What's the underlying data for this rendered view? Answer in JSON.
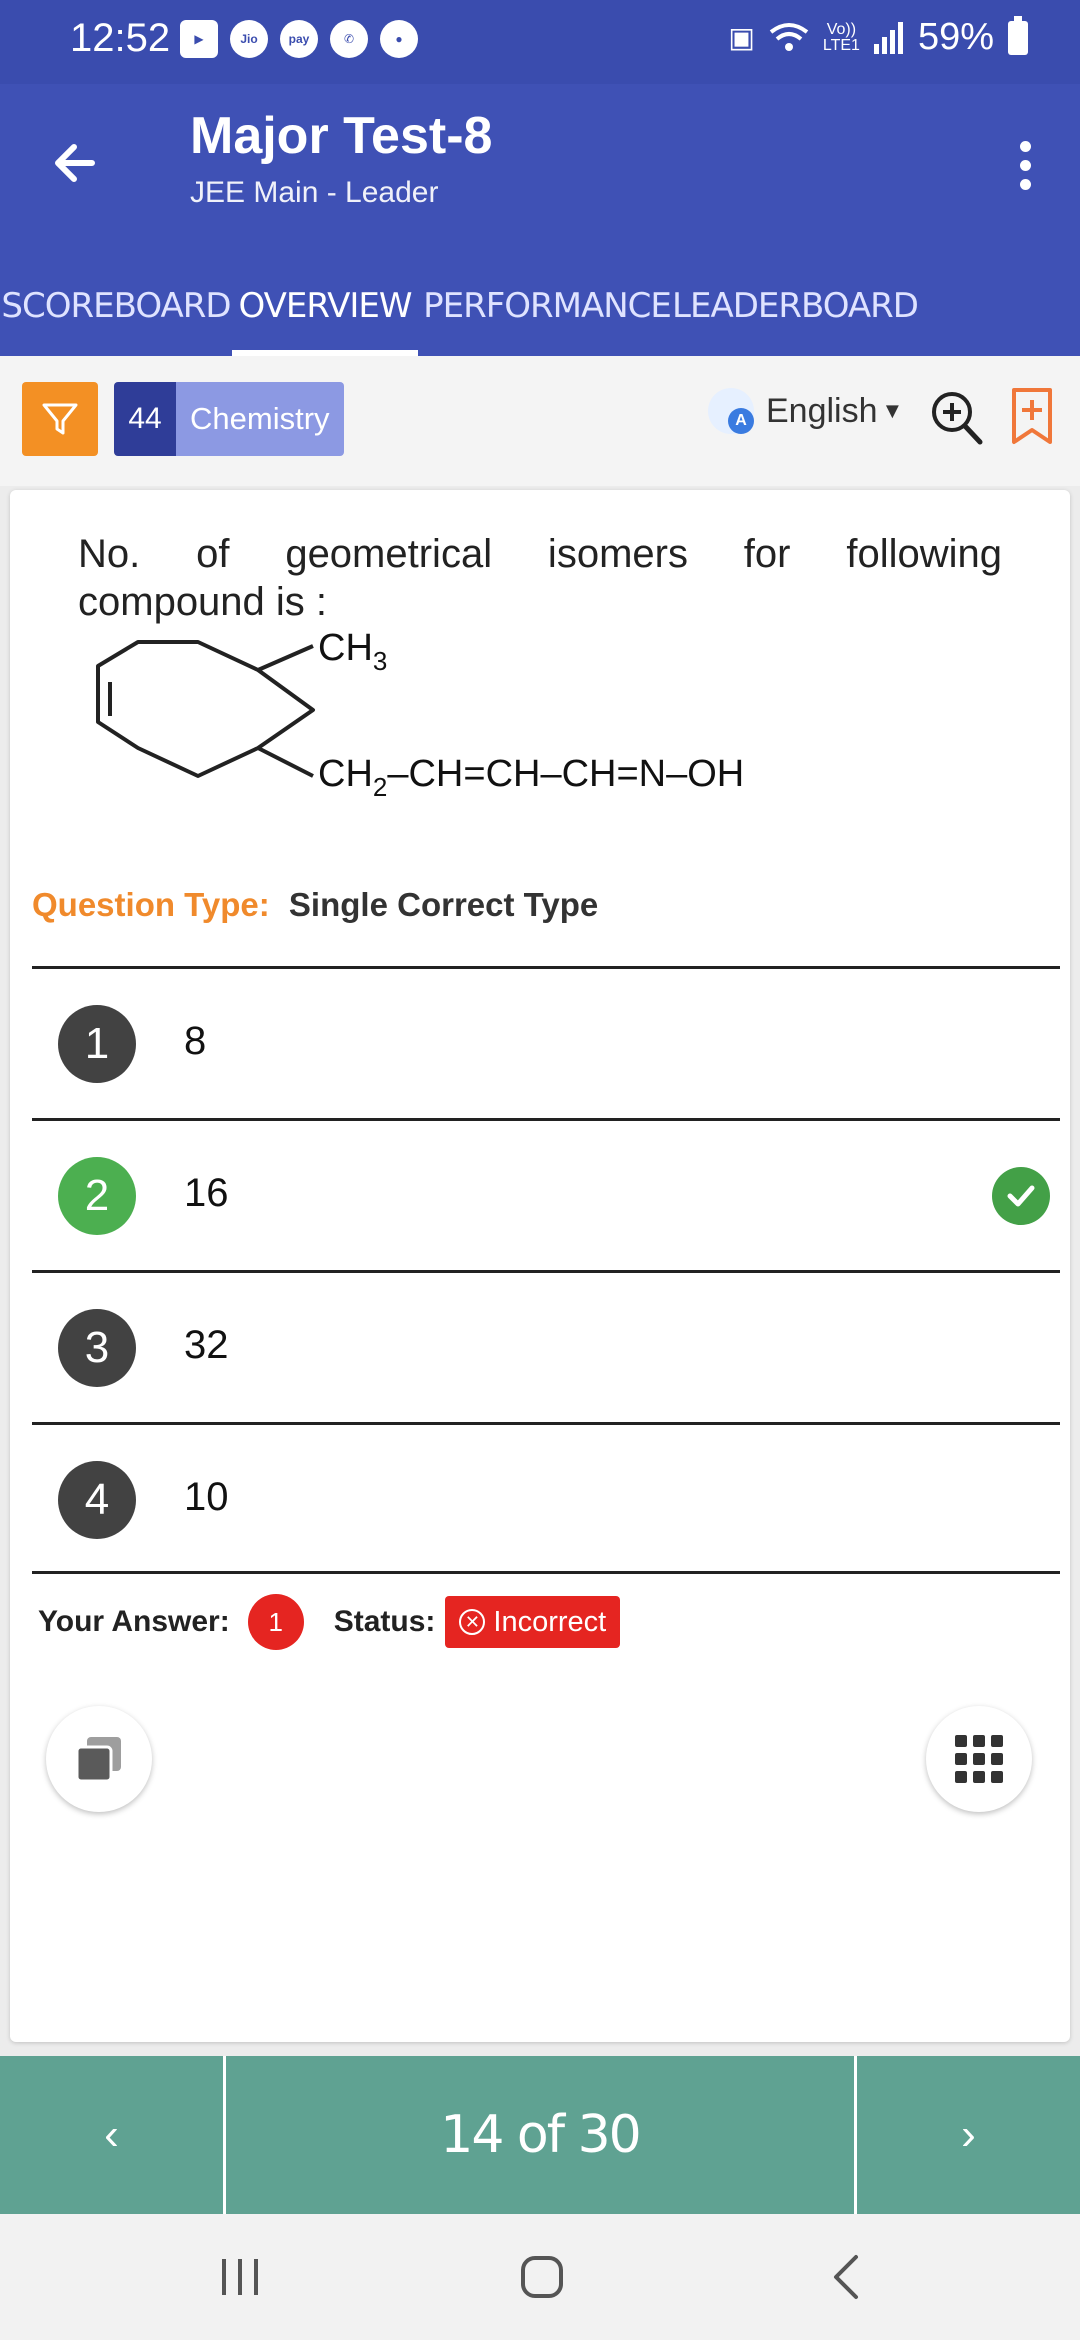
{
  "status_bar": {
    "time": "12:52",
    "battery": "59%",
    "left_icons": [
      "video-icon",
      "jio-icon",
      "paytm-icon",
      "phone-icon",
      "account-icon"
    ],
    "right_icons": [
      "battery-saver-icon",
      "wifi-icon",
      "volte-icon",
      "signal-icon",
      "battery-icon"
    ]
  },
  "header": {
    "title": "Major Test-8",
    "subtitle": "JEE Main - Leader"
  },
  "tabs": [
    {
      "label": "SCOREBOARD",
      "active": false
    },
    {
      "label": "OVERVIEW",
      "active": true
    },
    {
      "label": "PERFORMANCE",
      "active": false
    },
    {
      "label": "LEADERBOARD",
      "active": false
    }
  ],
  "toolbar": {
    "subject_count": "44",
    "subject_name": "Chemistry",
    "language": "English"
  },
  "question": {
    "text_line1": "No. of geometrical isomers for following",
    "text_line2": "compound is :",
    "structure_label_top": "CH",
    "structure_label_top_sub": "3",
    "structure_label_chain_a": "CH",
    "structure_label_chain_sub": "2",
    "structure_label_chain_b": "–CH=CH–CH=N–OH",
    "type_label": "Question Type:",
    "type_value": "Single Correct Type"
  },
  "options": [
    {
      "number": "1",
      "text": "8",
      "correct": false
    },
    {
      "number": "2",
      "text": "16",
      "correct": true
    },
    {
      "number": "3",
      "text": "32",
      "correct": false
    },
    {
      "number": "4",
      "text": "10",
      "correct": false
    }
  ],
  "answer": {
    "your_answer_label": "Your Answer:",
    "your_answer_value": "1",
    "status_label": "Status:",
    "status_value": "Incorrect"
  },
  "bottom_nav": {
    "prev": "‹",
    "counter": "14 of 30",
    "next": "›"
  },
  "colors": {
    "primary": "#3f51b5",
    "accent_orange": "#f39024",
    "correct_green": "#4caf50",
    "incorrect_red": "#e52521",
    "nav_teal": "#5fa292"
  }
}
